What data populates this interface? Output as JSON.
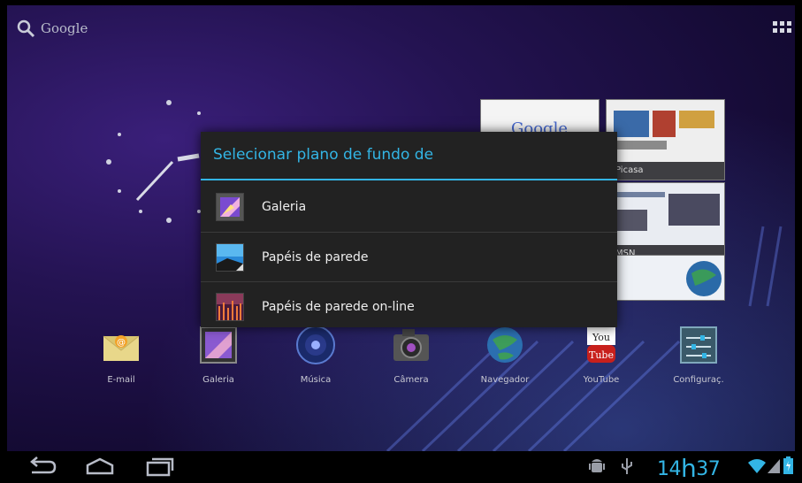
{
  "search": {
    "label": "Google"
  },
  "dialog": {
    "title": "Selecionar plano de fundo de",
    "options": [
      {
        "label": "Galeria",
        "icon": "gallery-icon"
      },
      {
        "label": "Papéis de parede",
        "icon": "wallpapers-icon"
      },
      {
        "label": "Papéis de parede on-line",
        "icon": "live-wallpapers-icon"
      }
    ]
  },
  "thumbnails": [
    {
      "caption": "Google"
    },
    {
      "caption": "Picasa"
    },
    {
      "caption": "MSN"
    }
  ],
  "hotseat": [
    {
      "label": "E-mail",
      "icon": "email-icon"
    },
    {
      "label": "Galeria",
      "icon": "gallery-icon"
    },
    {
      "label": "Música",
      "icon": "music-icon"
    },
    {
      "label": "Câmera",
      "icon": "camera-icon"
    },
    {
      "label": "Navegador",
      "icon": "browser-icon"
    },
    {
      "label": "YouTube",
      "icon": "youtube-icon"
    },
    {
      "label": "Configuraç.",
      "icon": "settings-icon"
    }
  ],
  "status": {
    "hour": "14",
    "h_sep": "h",
    "minute": "37",
    "accent": "#33b5e5"
  }
}
